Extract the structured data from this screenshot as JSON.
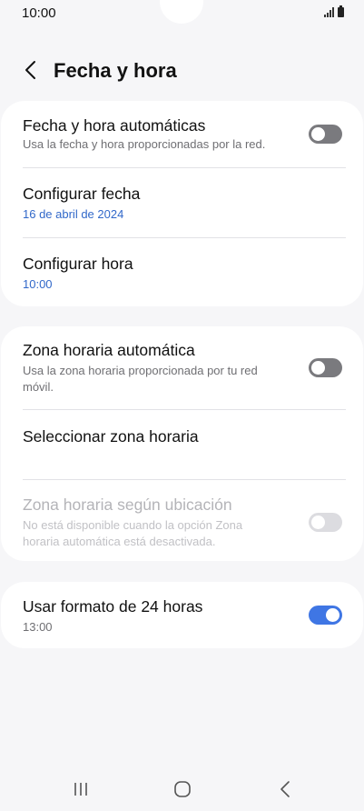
{
  "status_bar": {
    "time": "10:00"
  },
  "header": {
    "title": "Fecha y hora",
    "back_icon": "chevron-left-icon"
  },
  "section1": {
    "auto_datetime": {
      "title": "Fecha y hora automáticas",
      "subtitle": "Usa la fecha y hora proporcionadas por la red.",
      "toggle_state": "off"
    },
    "set_date": {
      "title": "Configurar fecha",
      "value": "16 de abril de 2024"
    },
    "set_time": {
      "title": "Configurar hora",
      "value": "10:00"
    }
  },
  "section2": {
    "auto_timezone": {
      "title": "Zona horaria automática",
      "subtitle_line1": "Usa la zona horaria proporcionada por tu red",
      "subtitle_line2": "móvil.",
      "toggle_state": "off"
    },
    "select_timezone": {
      "title": "Seleccionar zona horaria"
    },
    "location_timezone": {
      "title": "Zona horaria según ubicación",
      "subtitle_line1": "No está disponible cuando la opción Zona",
      "subtitle_line2": "horaria automática está desactivada.",
      "toggle_state": "disabled"
    }
  },
  "section3": {
    "format_24h": {
      "title": "Usar formato de 24 horas",
      "value": "13:00",
      "toggle_state": "on"
    }
  },
  "colors": {
    "accent": "#3f76e4",
    "link_value": "#3168c9",
    "background": "#f6f6f8",
    "card": "#ffffff"
  },
  "nav_icons": [
    "recent-apps-icon",
    "home-icon",
    "back-icon"
  ]
}
